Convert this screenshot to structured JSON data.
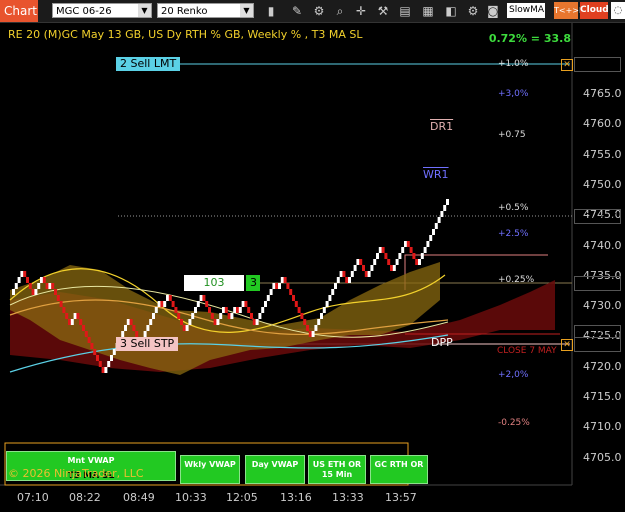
{
  "toolbar": {
    "title": "Chart",
    "instrument": "MGC 06-26",
    "bar_type": "20 Renko",
    "indicator_box": "SlowMA",
    "tkr_label": "T<+>K",
    "cloud_label": "Cloud",
    "icons": [
      "bar-chart-icon",
      "draw-icon",
      "properties-icon",
      "zoom-icon",
      "crosshair-icon",
      "wrench-icon",
      "data-box-icon",
      "calendar-icon",
      "chart-style-icon",
      "settings-icon",
      "camera-icon"
    ]
  },
  "chart": {
    "header": "RE 20  (M)GC May 13 GB, US Dy RTH % GB, Weekly % , T3 MA SL",
    "performance": "0.72% = 33.8",
    "price_ticks": [
      "4765.0",
      "4760.0",
      "4755.0",
      "4750.0",
      "4745.0",
      "4740.0",
      "4735.0",
      "4730.0",
      "4725.0",
      "4720.0",
      "4715.0",
      "4710.0",
      "4705.0"
    ],
    "price_tags": [
      {
        "label": "4769.8",
        "color": "#e6e6e6"
      },
      {
        "label": "4744.7",
        "color": "#ffffff"
      },
      {
        "label": "4733.7",
        "color": "#e8c79a"
      },
      {
        "label": "4725.6",
        "color": "#5bd1e6"
      },
      {
        "label": "4723.7",
        "color": "#f4c4c4"
      }
    ],
    "time_ticks": [
      "07:10",
      "08:22",
      "08:49",
      "10:33",
      "12:05",
      "13:16",
      "13:33",
      "13:57"
    ],
    "orders": {
      "sell_lmt": "2 Sell LMT",
      "sell_stp": "3 Sell STP",
      "position_qty": "103",
      "position_side": "3"
    },
    "levels": {
      "plus1": "+1.0%",
      "plus3": "+3,0%",
      "plus075": "+0.75",
      "plus05": "+0.5%",
      "plus25": "+2.5%",
      "plus025": "+0.25%",
      "plus2": "+2,0%",
      "minus025": "-0.25%",
      "dr1": "DR1",
      "wr1": "WR1",
      "dpp": "DPP",
      "close_may": "CLOSE 7 MAY"
    },
    "buttons": [
      {
        "label": "Mnt VWAP"
      },
      {
        "label": "T3 MA SL"
      },
      {
        "label": "Wkly VWAP"
      },
      {
        "label": "Day VWAP"
      },
      {
        "label": "US ETH OR 15 Min"
      },
      {
        "label": "GC RTH OR"
      }
    ],
    "copyright": "© 2026 NinjaTrader, LLC",
    "colors": {
      "up": "#ffffff",
      "down": "#e01818",
      "cloud": "#8a6a10",
      "cloud_red": "#6a0a0a",
      "accent": "#e8542e"
    }
  }
}
